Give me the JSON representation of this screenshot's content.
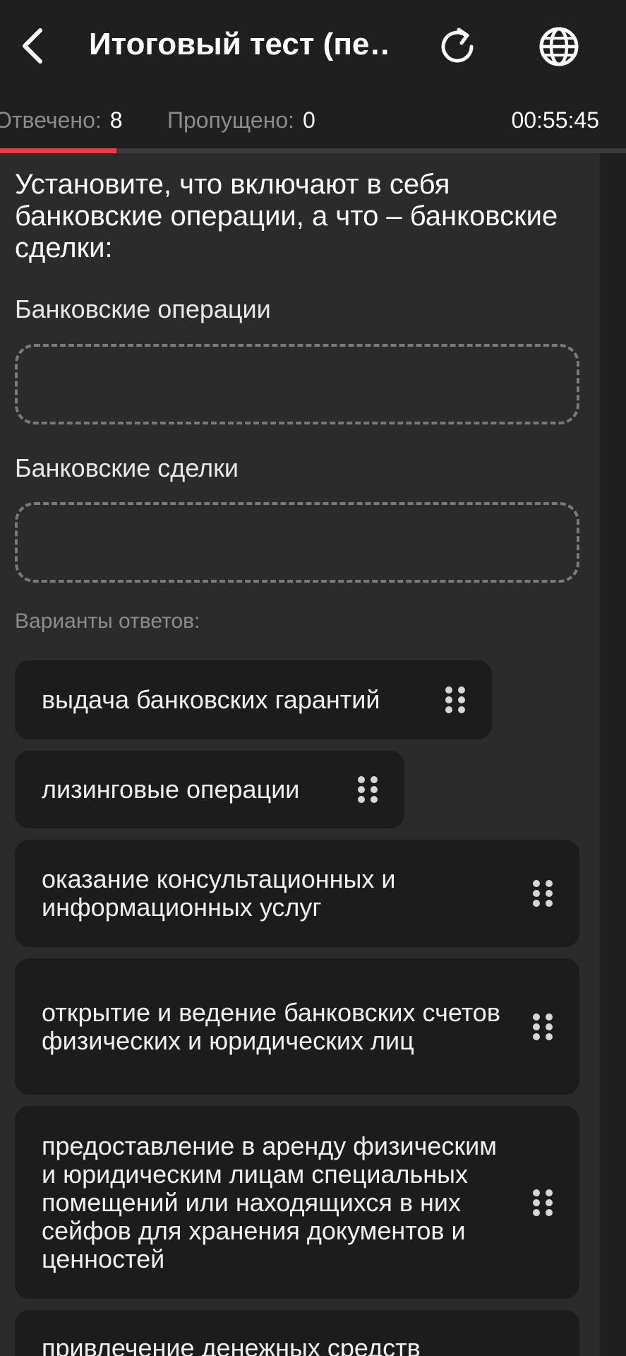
{
  "header": {
    "title": "Итоговый тест (пе…",
    "back_icon": "chevron-left-icon",
    "refresh_icon": "refresh-icon",
    "language_icon": "globe-icon"
  },
  "status": {
    "answered_label": "Отвечено:",
    "answered_value": "8",
    "skipped_label": "Пропущено:",
    "skipped_value": "0",
    "timer": "00:55:45",
    "progress_fraction": 0.186,
    "progress_color": "#e5404a"
  },
  "question": {
    "text": "Установите, что включают в себя банковские операции, а что – банковские сделки:",
    "categories": [
      {
        "label": "Банковские операции"
      },
      {
        "label": "Банковские сделки"
      }
    ],
    "options_label": "Варианты ответов:",
    "options": [
      {
        "text": "выдача банковских гарантий"
      },
      {
        "text": "лизинговые операции"
      },
      {
        "text": "оказание консультационных и информационных услуг"
      },
      {
        "text": "открытие и ведение банковских счетов физических и юридических лиц"
      },
      {
        "text": "предоставление в аренду физическим и юридическим лицам специальных помещений или находящихся в них сейфов для хранения документов и ценностей"
      },
      {
        "text": "привлечение денежных средств"
      }
    ]
  }
}
